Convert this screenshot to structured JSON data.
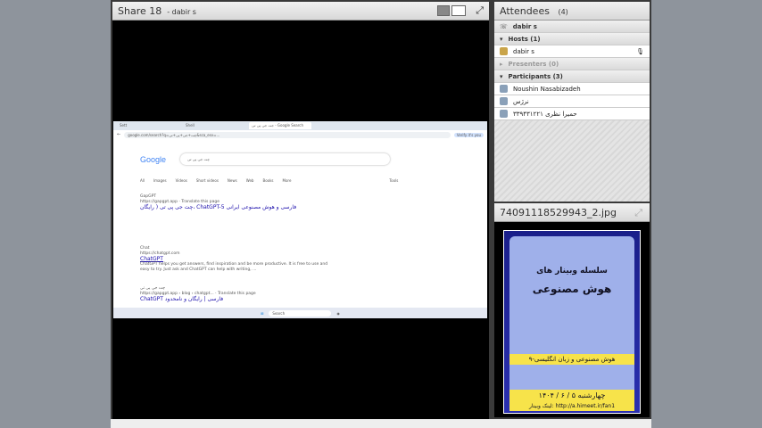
{
  "share": {
    "title": "Share 18",
    "presenter": "- dabir s"
  },
  "screen": {
    "tabs": [
      "Sett",
      "Shell",
      "جت جی پی تی - Google Search"
    ],
    "url": "google.com/search?q=چت+جی+پی+تی&sca_esv=...",
    "verify": "Verify it's you",
    "logo": "Google",
    "query": "چت جی پی تی",
    "search_tabs": [
      "All",
      "Images",
      "Videos",
      "Short videos",
      "News",
      "Web",
      "Books",
      "More",
      "Tools"
    ],
    "results": [
      {
        "site": "GapGPT",
        "url": "https://gapgpt.app",
        "translate": "Translate this page",
        "title": "چت جی پی تی ( رایگان، ChatGPT-5 فارسی و هوش مصنوعی ایرانی"
      },
      {
        "site": "Chat",
        "url": "https://chatgpt.com",
        "title": "ChatGPT",
        "snippet": "ChatGPT helps you get answers, find inspiration and be more productive. It is free to use and easy to try. Just ask and ChatGPT can help with writing, ..."
      },
      {
        "site": "چت جی پی تی",
        "url": "https://gapgpt.app › blog › chatgpt...",
        "translate": "Translate this page",
        "title": "ChatGPT فارسی | رایگان و نامحدود"
      }
    ],
    "taskbar_search": "Search"
  },
  "attendees": {
    "title": "Attendees",
    "count": "(4)",
    "me": "dabir s",
    "hosts": "Hosts (1)",
    "host_name": "dabir s",
    "presenters": "Presenters (0)",
    "participants": "Participants (3)",
    "participant_list": [
      "Noushin Nasabizadeh",
      "نرژس",
      "۳۳۹۴۳۱۲۲۱ حمیرا نظری"
    ]
  },
  "file": {
    "name": "74091118529943_2.jpg",
    "poster": {
      "subtitle": "سلسله وبینار های",
      "title": "هوش مصنوعی",
      "highlight": "۹-هوش مصنوعی و زبان انگلیسی",
      "date": "چهارشنبه ۵ / ۶ / ۱۴۰۴",
      "link": "لینک وبینار: http://a.himeet.ir/fan1"
    }
  }
}
